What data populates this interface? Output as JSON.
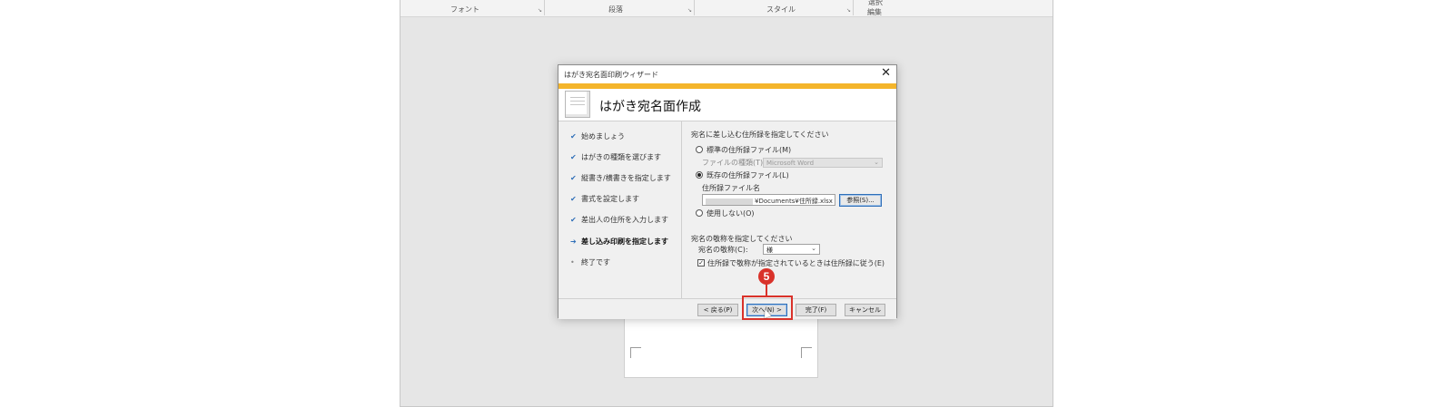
{
  "ribbon": {
    "groups": [
      "フォント",
      "段落",
      "スタイル",
      "編集"
    ],
    "top_fragment": "選択"
  },
  "dialog": {
    "title": "はがき宛名面印刷ウィザード",
    "close_glyph": "✕",
    "header_title": "はがき宛名面作成",
    "steps": [
      {
        "mark": "✔",
        "label": "始めましょう"
      },
      {
        "mark": "✔",
        "label": "はがきの種類を選びます"
      },
      {
        "mark": "✔",
        "label": "縦書き/横書きを指定します"
      },
      {
        "mark": "✔",
        "label": "書式を設定します"
      },
      {
        "mark": "✔",
        "label": "差出人の住所を入力します"
      },
      {
        "mark": "➔",
        "label": "差し込み印刷を指定します"
      },
      {
        "mark": "•",
        "label": "終了です"
      }
    ],
    "address_section": {
      "heading": "宛名に差し込む住所録を指定してください",
      "option_standard": "標準の住所録ファイル(M)",
      "file_type_label": "ファイルの種類(T):",
      "file_type_value": "Microsoft Word",
      "option_existing": "既存の住所録ファイル(L)",
      "file_name_label": "住所録ファイル名",
      "file_path": "¥Documents¥住所録.xlsx",
      "browse_label": "参照(S)...",
      "option_none": "使用しない(O)"
    },
    "honorific_section": {
      "heading": "宛名の敬称を指定してください",
      "label": "宛名の敬称(C):",
      "value": "様",
      "checkbox_label": "住所録で敬称が指定されているときは住所録に従う(E)",
      "checkbox_mark": "✓"
    },
    "buttons": {
      "back": "< 戻る(P)",
      "next": "次へ(N) >",
      "finish": "完了(F)",
      "cancel": "キャンセル"
    }
  },
  "annotation": {
    "step_number": "5",
    "color": "#d9322a"
  },
  "colors": {
    "accent_bar": "#f4b52b",
    "check_blue": "#2f6fb8"
  }
}
